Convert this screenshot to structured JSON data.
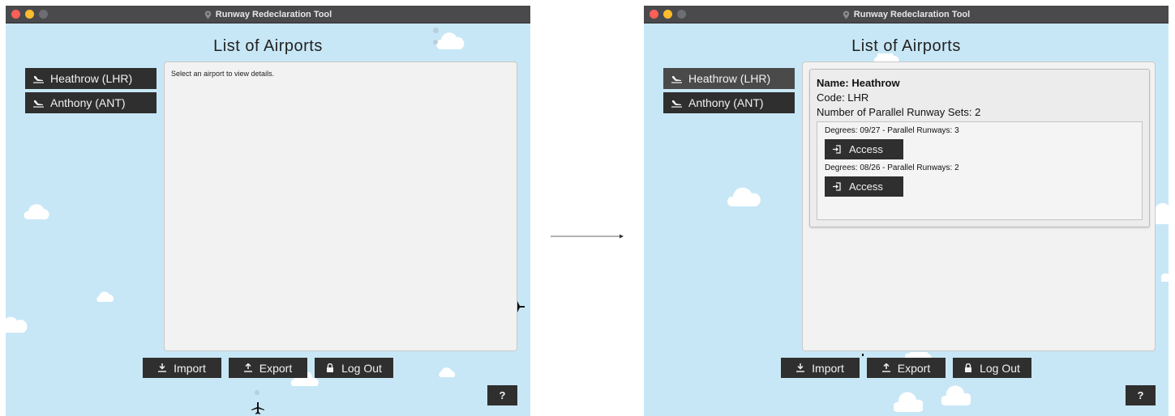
{
  "left_window": {
    "title": "Runway Redeclaration Tool",
    "heading": "List of Airports",
    "airports": [
      {
        "label": "Heathrow (LHR)",
        "icon": "plane-landing-icon"
      },
      {
        "label": "Anthony (ANT)",
        "icon": "plane-landing-icon"
      }
    ],
    "placeholder": "Select an airport to view details.",
    "buttons": {
      "import": "Import",
      "export": "Export",
      "logout": "Log Out",
      "help": "?"
    }
  },
  "right_window": {
    "title": "Runway Redeclaration Tool",
    "heading": "List of Airports",
    "airports": [
      {
        "label": "Heathrow (LHR)",
        "icon": "plane-landing-icon",
        "selected": true
      },
      {
        "label": "Anthony (ANT)",
        "icon": "plane-landing-icon"
      }
    ],
    "details": {
      "name": "Name: Heathrow",
      "code": "Code: LHR",
      "runway_sets": "Number of Parallel Runway Sets: 2",
      "runways": [
        {
          "label": "Degrees: 09/27 - Parallel Runways: 3",
          "button": "Access"
        },
        {
          "label": "Degrees: 08/26 - Parallel Runways: 2",
          "button": "Access"
        }
      ]
    },
    "buttons": {
      "import": "Import",
      "export": "Export",
      "logout": "Log Out",
      "help": "?"
    }
  },
  "colors": {
    "sky": "#c8e7f6",
    "titlebar": "#4a4a4d",
    "button": "#2f2f2f",
    "panel": "#f2f2f2"
  }
}
